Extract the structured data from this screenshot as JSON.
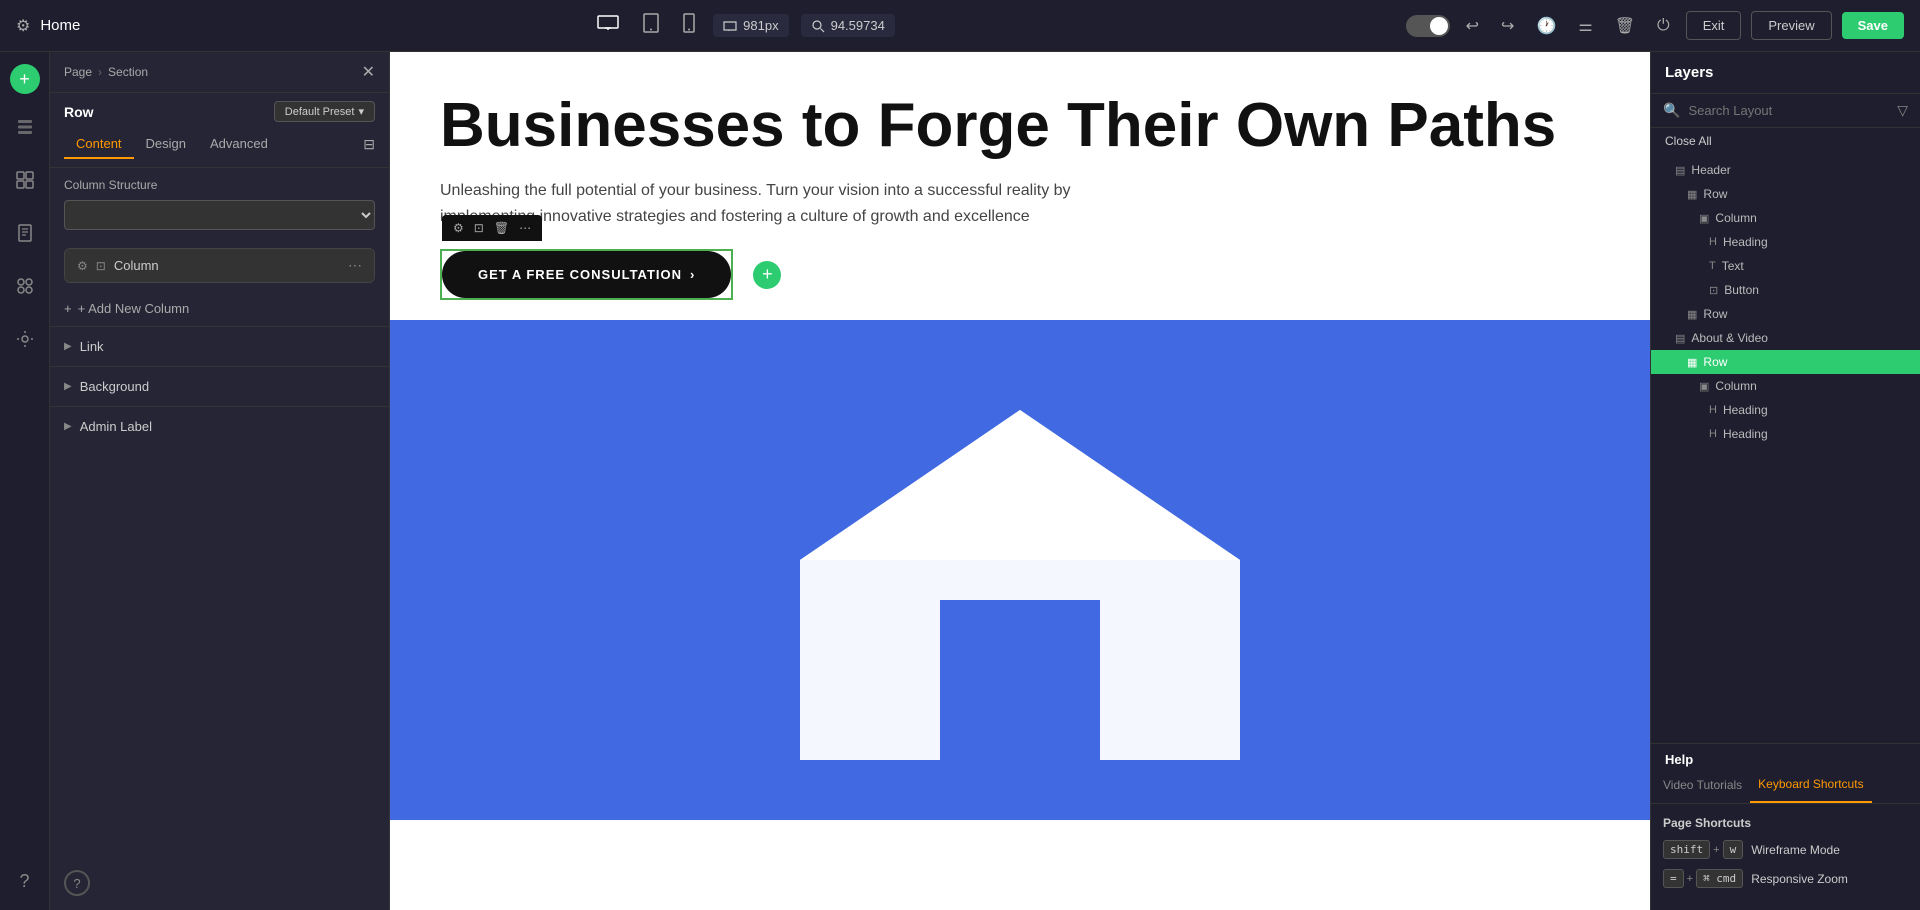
{
  "topbar": {
    "title": "Home",
    "gear_icon": "⚙",
    "resolution": "981px",
    "zoom": "94.59734",
    "device_desktop": "▭",
    "device_tablet": "▯",
    "device_mobile": "📱",
    "undo_icon": "↩",
    "redo_icon": "↪",
    "history_icon": "🕐",
    "columns_icon": "⚌",
    "trash_icon": "🗑",
    "power_icon": "⏻",
    "exit_label": "Exit",
    "preview_label": "Preview",
    "save_label": "Save"
  },
  "left_panel": {
    "breadcrumb_page": "Page",
    "breadcrumb_sep": "›",
    "breadcrumb_section": "Section",
    "row_label": "Row",
    "preset_label": "Default Preset",
    "tab_content": "Content",
    "tab_design": "Design",
    "tab_advanced": "Advanced",
    "column_structure_label": "Column Structure",
    "column_label": "Column",
    "add_column_label": "+ Add New Column",
    "link_label": "Link",
    "background_label": "Background",
    "admin_label": "Admin Label"
  },
  "canvas": {
    "heading": "Businesses to Forge Their Own Paths",
    "subtext": "Unleashing the full potential of your business. Turn your vision into a successful reality by implementing innovative strategies and fostering a culture of growth and excellence",
    "cta_button": "GET A FREE CONSULTATION",
    "cta_arrow": "›"
  },
  "right_panel": {
    "layers_title": "Layers",
    "search_placeholder": "Search Layout",
    "filter_icon": "▽",
    "close_all": "Close All",
    "items": [
      {
        "level": 0,
        "icon": "▤",
        "label": "Header",
        "type": "section"
      },
      {
        "level": 1,
        "icon": "▦",
        "label": "Row",
        "type": "row"
      },
      {
        "level": 2,
        "icon": "▣",
        "label": "Column",
        "type": "column"
      },
      {
        "level": 3,
        "icon": "H",
        "label": "Heading",
        "type": "heading"
      },
      {
        "level": 3,
        "icon": "T",
        "label": "Text",
        "type": "text"
      },
      {
        "level": 3,
        "icon": "⊡",
        "label": "Button",
        "type": "button"
      },
      {
        "level": 1,
        "icon": "▦",
        "label": "Row",
        "type": "row"
      },
      {
        "level": 0,
        "icon": "▤",
        "label": "About & Video",
        "type": "section"
      },
      {
        "level": 1,
        "icon": "▦",
        "label": "Row",
        "type": "row",
        "active": true
      },
      {
        "level": 2,
        "icon": "▣",
        "label": "Column",
        "type": "column"
      },
      {
        "level": 3,
        "icon": "H",
        "label": "Heading",
        "type": "heading"
      },
      {
        "level": 3,
        "icon": "H",
        "label": "Heading",
        "type": "heading"
      }
    ],
    "help_title": "Help",
    "tab_video": "Video Tutorials",
    "tab_keyboard": "Keyboard Shortcuts",
    "shortcuts_section": "Page Shortcuts",
    "shortcuts": [
      {
        "keys": [
          "shift",
          "+",
          "w"
        ],
        "label": "Wireframe Mode"
      },
      {
        "keys": [
          "=",
          "+",
          "⌘ cmd"
        ],
        "label": "Responsive Zoom"
      }
    ]
  }
}
